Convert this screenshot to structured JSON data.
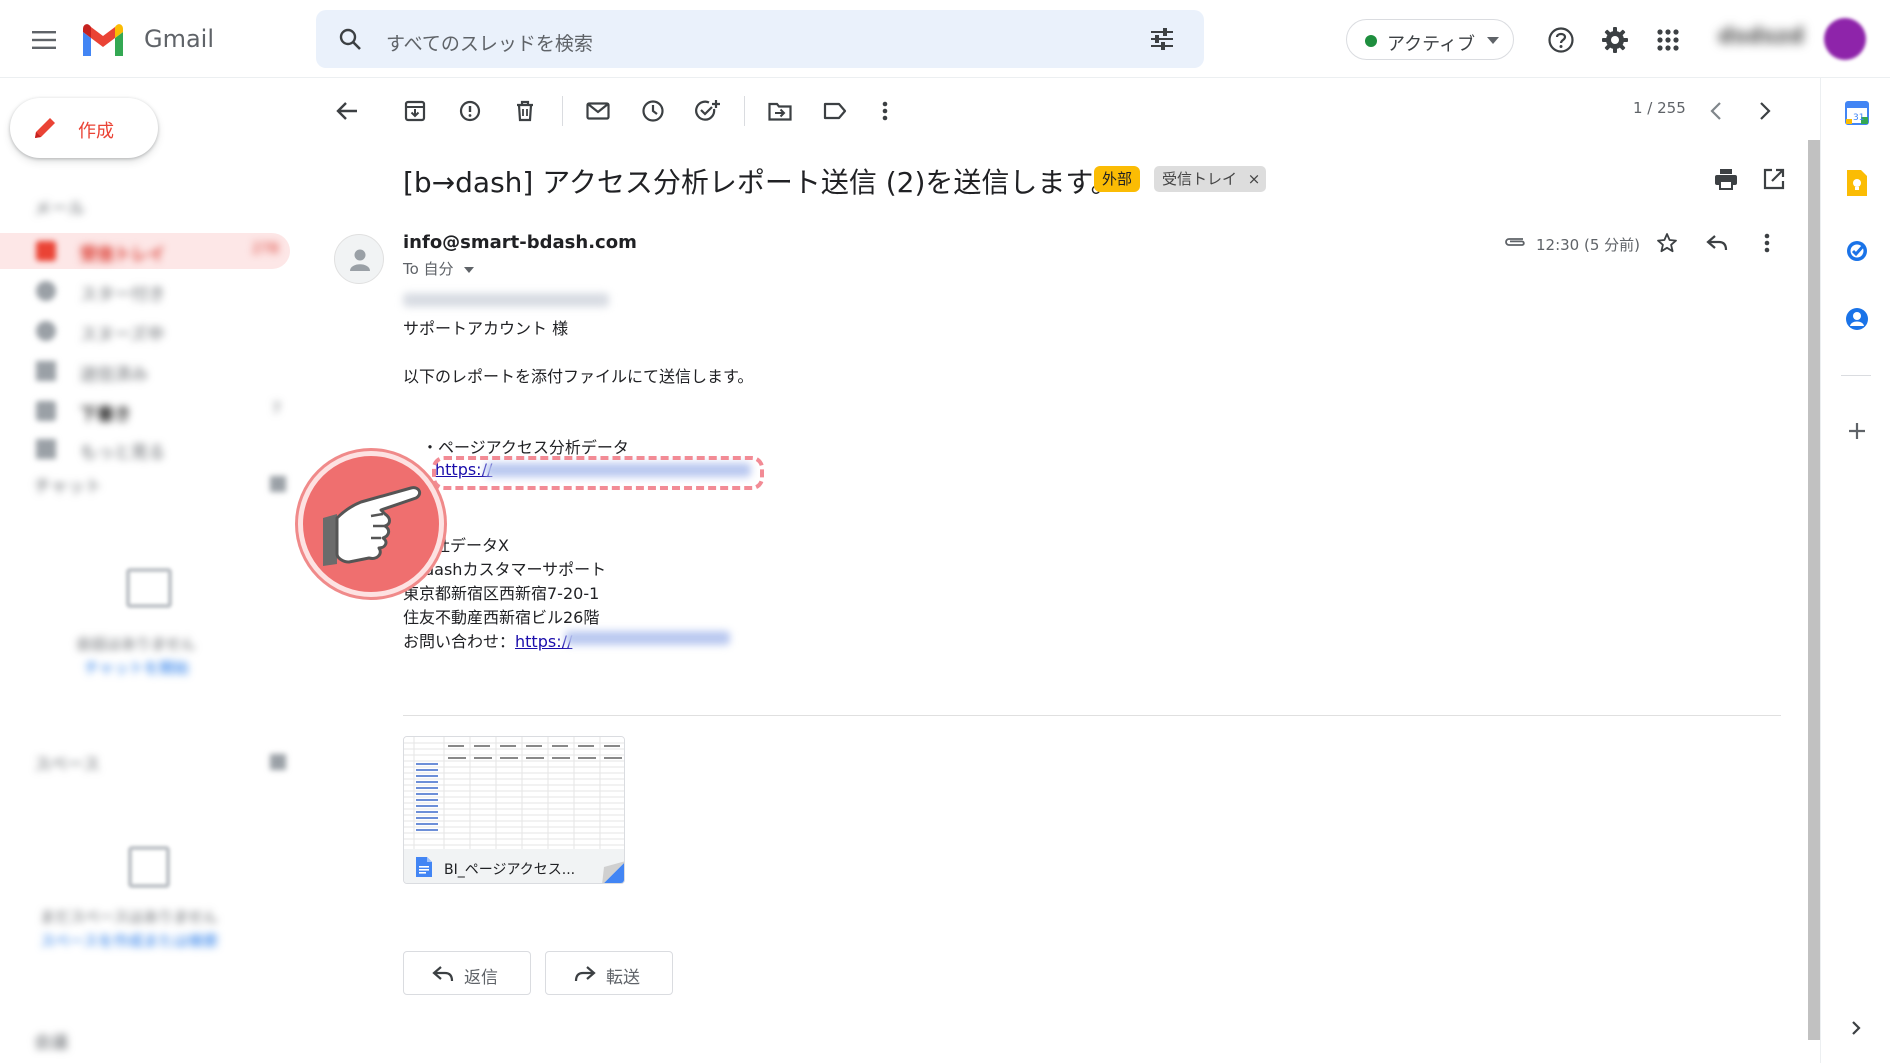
{
  "header": {
    "app_name": "Gmail",
    "search_placeholder": "すべてのスレッドを検索",
    "status_label": "アクティブ",
    "status_color": "#1e8e3e",
    "account_name": "dsdszd"
  },
  "sidebar": {
    "compose_label": "作成",
    "mail_section": "メール",
    "items": [
      {
        "label": "受信トレイ",
        "count": "278"
      },
      {
        "label": "スター付き"
      },
      {
        "label": "スヌーズ中"
      },
      {
        "label": "送信済み"
      },
      {
        "label": "下書き",
        "count": "7"
      },
      {
        "label": "もっと見る"
      }
    ],
    "chat_section": "チャット",
    "chat_empty": "会話はありません",
    "chat_start": "チャットを開始",
    "spaces_section": "スペース",
    "spaces_empty": "まだスペースはありません",
    "spaces_find": "スペースを作成または検索",
    "meet_section": "会議"
  },
  "toolbar": {
    "pagination": "1 / 255"
  },
  "email": {
    "subject": "[b→dash] アクセス分析レポート送信 (2)を送信します。",
    "label_external": "外部",
    "label_inbox": "受信トレイ",
    "label_inbox_remove": "×",
    "sender": "info@smart-bdash.com",
    "to_label": "To 自分",
    "time": "12:30 (5 分前)",
    "body": {
      "recipient_line": "サポートアカウント 様",
      "intro": "以下のレポートを添付ファイルにて送信します。",
      "bullet": "・ページアクセス分析データ",
      "link_prefix": "https://",
      "sig_company": "会社データX",
      "sig_team": "dashカスタマーサポート",
      "sig_address1": "東京都新宿区西新宿7-20-1",
      "sig_address2": "住友不動産西新宿ビル26階",
      "sig_contact_label": "お問い合わせ：",
      "sig_contact_link": "https://"
    },
    "attachment_name": "BI_ページアクセス..."
  },
  "actions": {
    "reply": "返信",
    "forward": "転送"
  },
  "colors": {
    "gmail_red": "#ea4335",
    "highlight": "#f28b95",
    "hand_circle": "#ef6f6f",
    "external_chip": "#fbbc04"
  }
}
